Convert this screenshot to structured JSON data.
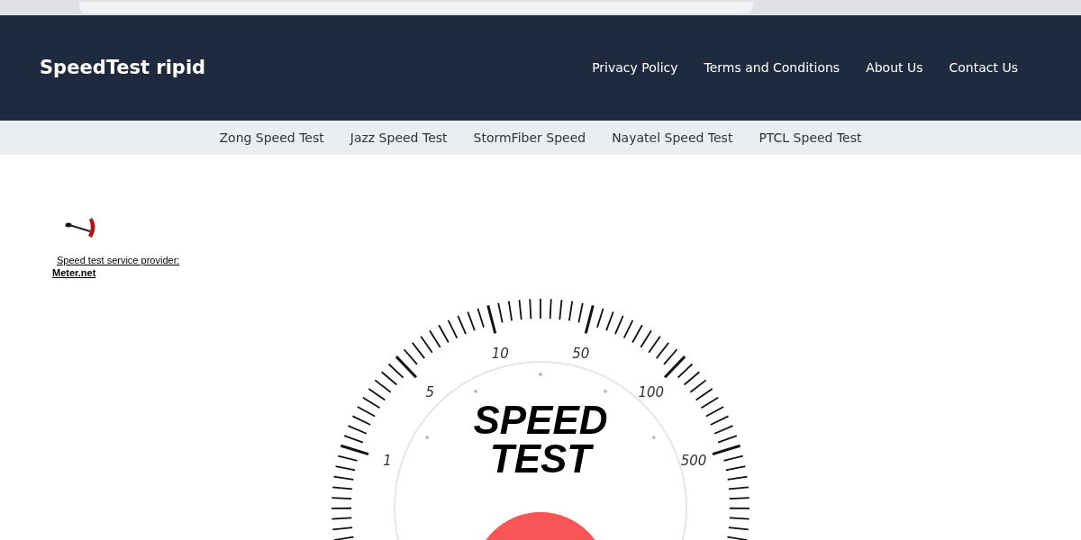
{
  "brand": "SpeedTest ripid",
  "top_nav": [
    "Privacy Policy",
    "Terms and Conditions",
    "About Us",
    "Contact Us"
  ],
  "sub_nav": [
    "Zong Speed Test",
    "Jazz Speed Test",
    "StormFiber Speed",
    "Nayatel Speed Test",
    "PTCL Speed Test"
  ],
  "provider": {
    "label": "Speed test service provider:",
    "link": "Meter.net"
  },
  "gauge": {
    "title_lines": [
      "SPEED",
      "TEST"
    ],
    "scale_labels": [
      "1",
      "5",
      "10",
      "50",
      "100",
      "500"
    ]
  }
}
